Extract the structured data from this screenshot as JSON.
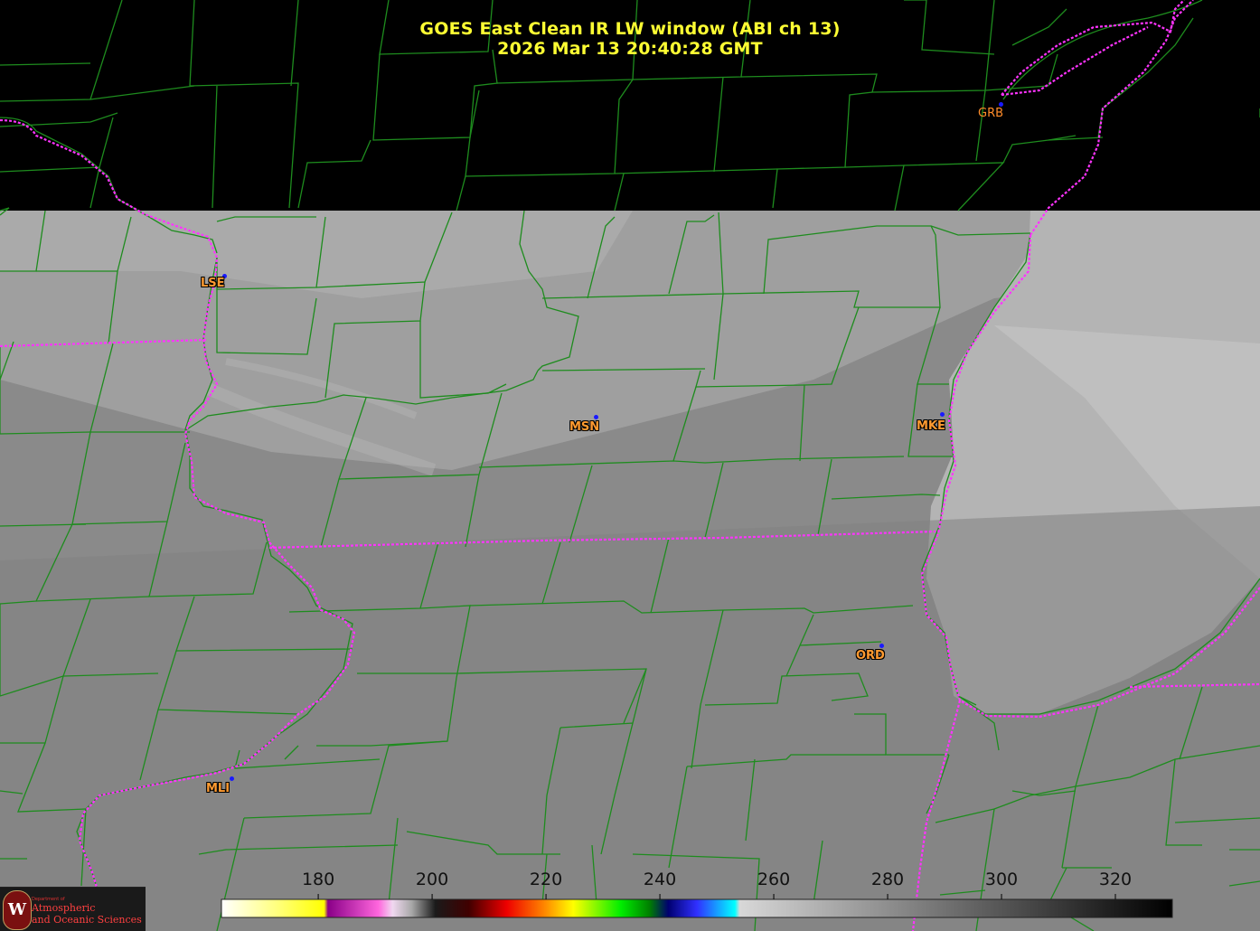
{
  "title": {
    "line1": "GOES East Clean IR LW window (ABI ch 13)",
    "line2": "2026 Mar 13  20:40:28 GMT"
  },
  "stations": [
    {
      "code": "GRB"
    },
    {
      "code": "LSE"
    },
    {
      "code": "MSN"
    },
    {
      "code": "MKE"
    },
    {
      "code": "ORD"
    },
    {
      "code": "MLI"
    }
  ],
  "colorbar": {
    "min": 163,
    "max": 330,
    "ticks": [
      "180",
      "200",
      "220",
      "240",
      "260",
      "280",
      "300",
      "320"
    ],
    "tick_values": [
      180,
      200,
      220,
      240,
      260,
      280,
      300,
      320
    ]
  },
  "logo": {
    "dept": "Department of",
    "line1": "Atmospheric",
    "line2": "and Oceanic Sciences",
    "seal": "W"
  },
  "colors": {
    "county_lines": "#1e8c1e",
    "state_lines": "#ff33ff",
    "title": "#ffff33",
    "station_label": "#ff9a30",
    "station_dot": "#1a1aff"
  }
}
